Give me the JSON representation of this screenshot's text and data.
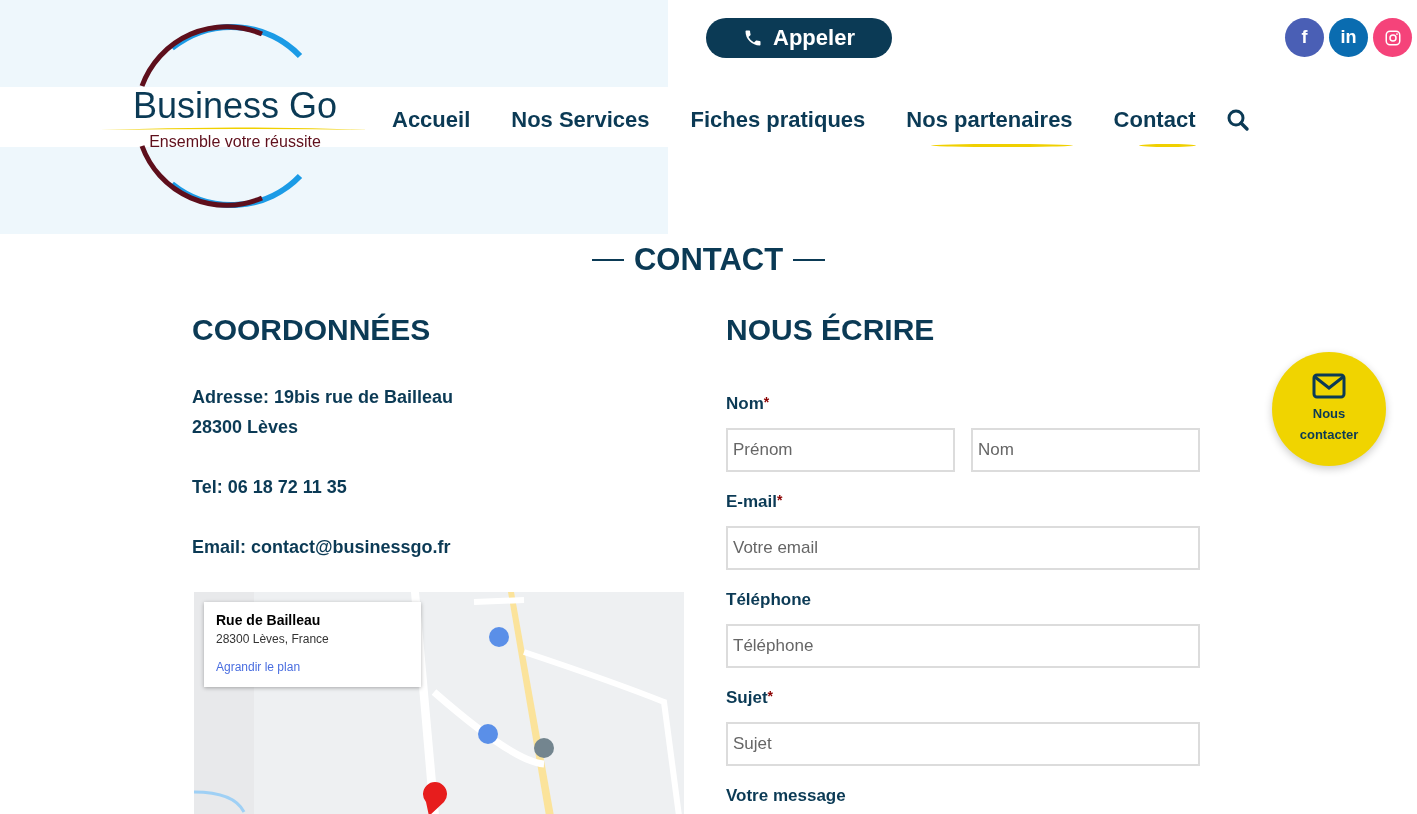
{
  "logo": {
    "name": "Business Go",
    "tagline": "Ensemble votre réussite"
  },
  "call_button": {
    "label": "Appeler"
  },
  "social": [
    {
      "kind": "facebook",
      "glyph": "f",
      "color": "#4a5fb5"
    },
    {
      "kind": "linkedin",
      "glyph": "in",
      "color": "#0a6cb0"
    },
    {
      "kind": "instagram",
      "color": "#f5437a"
    }
  ],
  "nav": [
    {
      "label": "Accueil",
      "underlined": false
    },
    {
      "label": "Nos Services",
      "underlined": false
    },
    {
      "label": "Fiches pratiques",
      "underlined": false
    },
    {
      "label": "Nos partenaires",
      "underlined": true
    },
    {
      "label": "Contact",
      "underlined": true
    }
  ],
  "page_title": "CONTACT",
  "contact_info": {
    "heading": "COORDONNÉES",
    "address_lines": [
      "Adresse: 19bis rue de Bailleau",
      "28300 Lèves"
    ],
    "phone": "Tel: 06 18 72 11 35",
    "email": "Email: contact@businessgo.fr"
  },
  "map": {
    "kind": "picture",
    "card": {
      "title": "Rue de Bailleau",
      "address": "28300 Lèves, France",
      "link": "Agrandir le plan"
    }
  },
  "form": {
    "heading": "NOUS ÉCRIRE",
    "fields": [
      {
        "label": "Nom",
        "required_mark": "*",
        "inputs": [
          {
            "placeholder": "Prénom"
          },
          {
            "placeholder": "Nom"
          }
        ]
      },
      {
        "label": "E-mail",
        "required_mark": "*",
        "inputs": [
          {
            "placeholder": "Votre email"
          }
        ]
      },
      {
        "label": "Téléphone",
        "inputs": [
          {
            "placeholder": "Téléphone"
          }
        ]
      },
      {
        "label": "Sujet",
        "required_mark": "*",
        "inputs": [
          {
            "placeholder": "Sujet"
          }
        ]
      },
      {
        "label": "Votre message"
      }
    ]
  },
  "floating_button": {
    "lines": [
      "Nous",
      "contacter"
    ]
  }
}
